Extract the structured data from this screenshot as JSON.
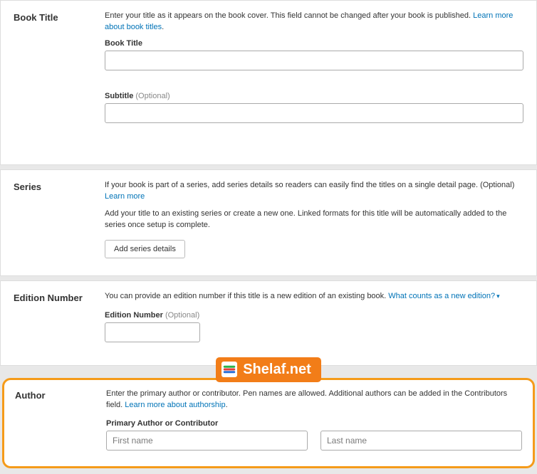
{
  "bookTitle": {
    "title": "Book Title",
    "desc": "Enter your title as it appears on the book cover. This field cannot be changed after your book is published. ",
    "helpLink": "Learn more about book titles",
    "fieldLabel": "Book Title",
    "subtitleLabel": "Subtitle ",
    "subtitleOptional": "(Optional)"
  },
  "series": {
    "title": "Series",
    "desc1a": "If your book is part of a series, add series details so readers can easily find the titles on a single detail page. (Optional) ",
    "learnMore": "Learn more",
    "desc2": "Add your title to an existing series or create a new one. Linked formats for this title will be automatically added to the series once setup is complete.",
    "button": "Add series details"
  },
  "edition": {
    "title": "Edition Number",
    "desc": "You can provide an edition number if this title is a new edition of an existing book. ",
    "helpLink": "What counts as a new edition?",
    "fieldLabel": "Edition Number ",
    "optional": "(Optional)"
  },
  "logo": {
    "text": "Shelaf.net"
  },
  "author": {
    "title": "Author",
    "desc": "Enter the primary author or contributor. Pen names are allowed. Additional authors can be added in the Contributors field. ",
    "helpLink": "Learn more about authorship",
    "fieldLabel": "Primary Author or Contributor",
    "firstPlaceholder": "First name",
    "lastPlaceholder": "Last name"
  }
}
